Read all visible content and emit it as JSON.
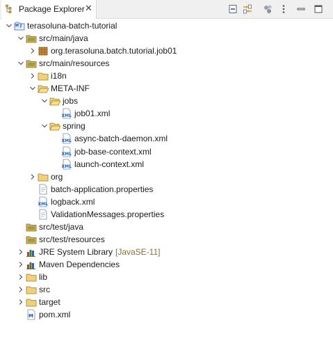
{
  "tab": {
    "title": "Package Explorer",
    "close": "✕"
  },
  "toolbar": [
    {
      "name": "collapse-all-icon"
    },
    {
      "name": "link-with-editor-icon"
    },
    {
      "name": "select-working-set-icon"
    },
    {
      "name": "view-menu-icon"
    },
    {
      "name": "minimize-icon"
    },
    {
      "name": "maximize-icon"
    }
  ],
  "tree": [
    {
      "label": "terasoluna-batch-tutorial",
      "icon": "maven-project",
      "depth": 0,
      "twisty": "open",
      "selected": true
    },
    {
      "label": "src/main/java",
      "icon": "source-folder",
      "depth": 1,
      "twisty": "open"
    },
    {
      "label": "org.terasoluna.batch.tutorial.job01",
      "icon": "package",
      "depth": 2,
      "twisty": "closed"
    },
    {
      "label": "src/main/resources",
      "icon": "source-folder",
      "depth": 1,
      "twisty": "open"
    },
    {
      "label": "i18n",
      "icon": "folder",
      "depth": 2,
      "twisty": "closed"
    },
    {
      "label": "META-INF",
      "icon": "folder-open",
      "depth": 2,
      "twisty": "open"
    },
    {
      "label": "jobs",
      "icon": "folder-open",
      "depth": 3,
      "twisty": "open"
    },
    {
      "label": "job01.xml",
      "icon": "xml-file",
      "depth": 4,
      "twisty": "none"
    },
    {
      "label": "spring",
      "icon": "folder-open",
      "depth": 3,
      "twisty": "open"
    },
    {
      "label": "async-batch-daemon.xml",
      "icon": "xml-file",
      "depth": 4,
      "twisty": "none"
    },
    {
      "label": "job-base-context.xml",
      "icon": "xml-file",
      "depth": 4,
      "twisty": "none"
    },
    {
      "label": "launch-context.xml",
      "icon": "xml-file",
      "depth": 4,
      "twisty": "none"
    },
    {
      "label": "org",
      "icon": "folder",
      "depth": 2,
      "twisty": "closed"
    },
    {
      "label": "batch-application.properties",
      "icon": "properties-file",
      "depth": 2,
      "twisty": "none"
    },
    {
      "label": "logback.xml",
      "icon": "xml-file",
      "depth": 2,
      "twisty": "none"
    },
    {
      "label": "ValidationMessages.properties",
      "icon": "properties-file",
      "depth": 2,
      "twisty": "none"
    },
    {
      "label": "src/test/java",
      "icon": "source-folder",
      "depth": 1,
      "twisty": "none"
    },
    {
      "label": "src/test/resources",
      "icon": "source-folder",
      "depth": 1,
      "twisty": "none"
    },
    {
      "label": "JRE System Library",
      "decoration": "[JavaSE-11]",
      "icon": "library",
      "depth": 1,
      "twisty": "closed"
    },
    {
      "label": "Maven Dependencies",
      "icon": "library",
      "depth": 1,
      "twisty": "closed"
    },
    {
      "label": "lib",
      "icon": "folder",
      "depth": 1,
      "twisty": "closed"
    },
    {
      "label": "src",
      "icon": "folder",
      "depth": 1,
      "twisty": "closed"
    },
    {
      "label": "target",
      "icon": "folder",
      "depth": 1,
      "twisty": "closed"
    },
    {
      "label": "pom.xml",
      "icon": "pom-file",
      "depth": 1,
      "twisty": "none"
    }
  ]
}
